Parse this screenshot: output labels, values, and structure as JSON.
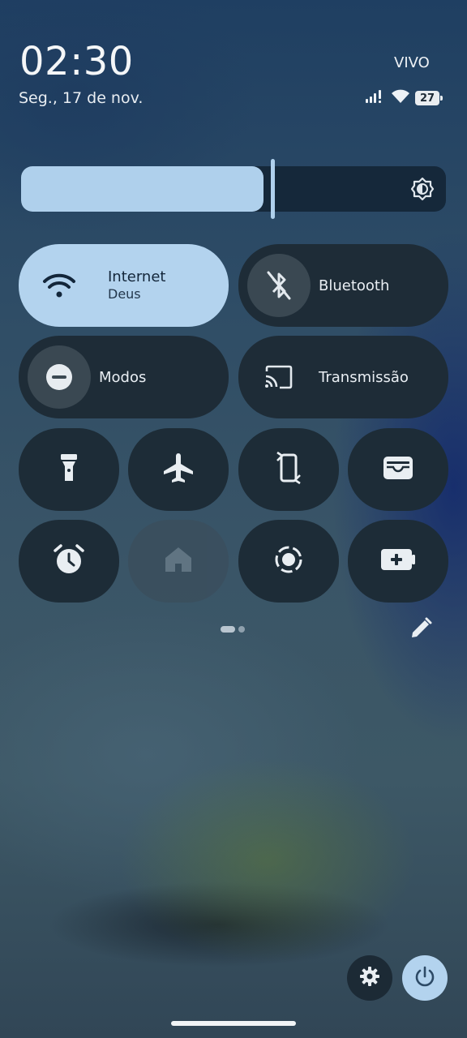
{
  "status_bar": {
    "time": "02:30",
    "date": "Seg., 17 de nov.",
    "carrier": "VIVO",
    "battery_level": "27",
    "icons": [
      "signal-icon",
      "wifi-icon",
      "battery-icon"
    ]
  },
  "brightness": {
    "level_fraction": 0.57,
    "icon": "auto-brightness-icon"
  },
  "tiles": {
    "internet": {
      "title": "Internet",
      "subtitle": "Deus",
      "icon": "wifi-icon",
      "active": true
    },
    "bluetooth": {
      "title": "Bluetooth",
      "icon": "bluetooth-disabled-icon",
      "active": false
    },
    "modes": {
      "title": "Modos",
      "icon": "do-not-disturb-icon",
      "active": false
    },
    "cast": {
      "title": "Transmissão",
      "icon": "cast-icon",
      "active": false
    }
  },
  "small_tiles": [
    {
      "icon": "flashlight-icon"
    },
    {
      "icon": "airplane-icon"
    },
    {
      "icon": "auto-rotate-icon"
    },
    {
      "icon": "wallet-icon"
    },
    {
      "icon": "alarm-icon"
    },
    {
      "icon": "home-icon",
      "disabled": true
    },
    {
      "icon": "screen-record-icon"
    },
    {
      "icon": "battery-saver-icon"
    }
  ],
  "pager": {
    "pages": 2,
    "current": 1
  },
  "colors": {
    "accent": "#b3d3ee",
    "tile_bg": "#1e2c37",
    "active_text": "#13263a"
  }
}
